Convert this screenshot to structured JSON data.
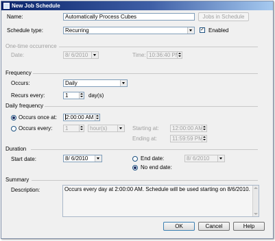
{
  "window": {
    "title": "New Job Schedule"
  },
  "name": {
    "label": "Name:",
    "value": "Automatically Process Cubes",
    "jobs_button": "Jobs in Schedule"
  },
  "schedule_type": {
    "label": "Schedule type:",
    "value": "Recurring",
    "enabled_label": "Enabled",
    "enabled_checked": true
  },
  "one_time": {
    "section": "One-time occurrence",
    "date_label": "Date:",
    "date_value": "8/ 6/2010",
    "time_label": "Time:",
    "time_value": "10:36:40 PM"
  },
  "frequency": {
    "section": "Frequency",
    "occurs_label": "Occurs:",
    "occurs_value": "Daily",
    "recurs_label": "Recurs every:",
    "recurs_value": "1",
    "recurs_unit": "day(s)"
  },
  "daily_frequency": {
    "section": "Daily frequency",
    "once_label": "Occurs once at:",
    "once_value": "2:00:00 AM",
    "every_label": "Occurs every:",
    "every_value": "1",
    "every_unit": "hour(s)",
    "starting_label": "Starting at:",
    "starting_value": "12:00:00 AM",
    "ending_label": "Ending at:",
    "ending_value": "11:59:59 PM"
  },
  "duration": {
    "section": "Duration",
    "start_label": "Start date:",
    "start_value": "8/ 6/2010",
    "end_label": "End date:",
    "end_value": "8/ 6/2010",
    "no_end_label": "No end date:"
  },
  "summary": {
    "section": "Summary",
    "description_label": "Description:",
    "description_text": "Occurs every day at 2:00:00 AM. Schedule will be used starting on 8/6/2010."
  },
  "buttons": {
    "ok": "OK",
    "cancel": "Cancel",
    "help": "Help"
  }
}
